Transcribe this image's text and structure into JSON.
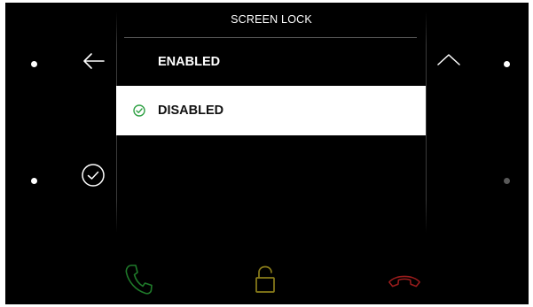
{
  "screen": {
    "title": "SCREEN LOCK"
  },
  "options": [
    {
      "label": "ENABLED",
      "selected": false
    },
    {
      "label": "DISABLED",
      "selected": true
    }
  ],
  "left_controls": {
    "back_icon": "arrow-left-icon",
    "confirm_icon": "check-circle-icon"
  },
  "right_controls": {
    "up_icon": "chevron-up-icon"
  },
  "bottom_bar": {
    "answer_icon": "phone-answer-icon",
    "unlock_icon": "unlock-icon",
    "hangup_icon": "phone-hangup-icon"
  },
  "colors": {
    "background": "#000000",
    "selected_row": "#ffffff",
    "check_green": "#2ea043",
    "answer_green": "#1f7a2a",
    "unlock_yellow": "#8a7d1a",
    "hangup_red": "#9a1c1c"
  }
}
